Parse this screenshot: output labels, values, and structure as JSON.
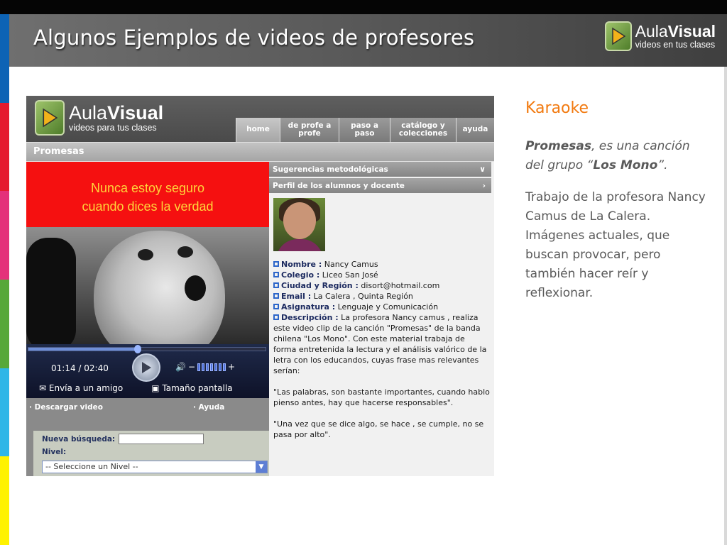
{
  "slide": {
    "title": "Algunos Ejemplos de videos de profesores",
    "brand": {
      "name_light": "Aula",
      "name_bold": "Visual",
      "tagline": "videos en tus clases"
    },
    "stripe_colors": [
      "#0d63b5",
      "#e5192e",
      "#e4317a",
      "#57a83a",
      "#2fb6e7",
      "#fff200"
    ],
    "accent_color": "#f27a10"
  },
  "shot": {
    "brand": {
      "name_light": "Aula",
      "name_bold": "Visual",
      "tagline": "videos para tus clases"
    },
    "tabs": [
      {
        "label": "home"
      },
      {
        "label": "de profe a profe"
      },
      {
        "label": "paso a paso"
      },
      {
        "label": "catálogo y colecciones"
      },
      {
        "label": "ayuda"
      }
    ],
    "section_title": "Promesas",
    "video": {
      "lyric_line1": "Nunca estoy seguro",
      "lyric_line2": "cuando dices la verdad",
      "time": "01:14 / 02:40",
      "progress": 0.46,
      "send_label": "Envía a un amigo",
      "size_label": "Tamaño pantalla"
    },
    "actions": {
      "download": "· Descargar video",
      "help": "· Ayuda"
    },
    "search": {
      "label": "Nueva búsqueda:",
      "level_label": "Nivel:",
      "level_selected": "-- Seleccione un Nivel --"
    },
    "accordion": {
      "suggestions": "Sugerencias metodológicas",
      "profile": "Perfil de los alumnos y docente"
    },
    "profile": {
      "nombre_k": "Nombre :",
      "nombre_v": "Nancy Camus",
      "colegio_k": "Colegio :",
      "colegio_v": "Liceo San José",
      "ciudad_k": "Ciudad y Región :",
      "ciudad_v": "disort@hotmail.com",
      "email_k": "Email :",
      "email_v": "La Calera , Quinta Región",
      "asignatura_k": "Asignatura :",
      "asignatura_v": "Lenguaje y Comunicación",
      "descripcion_k": "Descripción :",
      "descripcion_v": "La profesora Nancy camus , realiza este video clip de la canción \"Promesas\" de la banda chilena \"Los Mono\". Con este material trabaja de forma entretenida la lectura y el análisis valórico de la letra con los educandos, cuyas frase mas relevantes serían:",
      "quote1": "\"Las palabras, son bastante importantes, cuando hablo pienso antes, hay que hacerse responsables\".",
      "quote2": "\"Una vez que se dice algo, se hace , se cumple, no se pasa por alto\"."
    }
  },
  "side": {
    "heading": "Karaoke",
    "song_title": "Promesas",
    "song_mid": ", es una canción del grupo “",
    "band": "Los Mono",
    "song_end": "”.",
    "description": "Trabajo de la profesora Nancy Camus de La Calera. Imágenes actuales, que buscan provocar, pero también hacer reír y reflexionar."
  }
}
